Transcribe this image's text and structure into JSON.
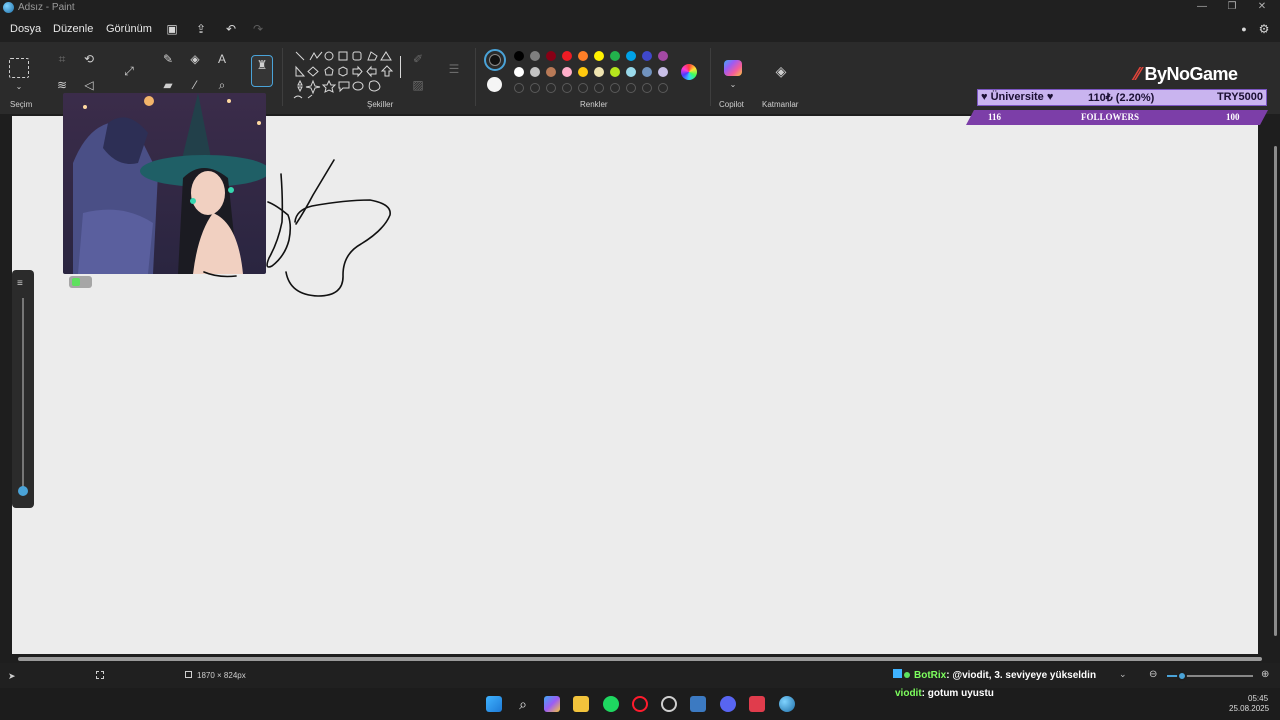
{
  "window": {
    "title": "Adsız - Paint"
  },
  "menu": {
    "file": "Dosya",
    "edit": "Düzenle",
    "view": "Görünüm"
  },
  "ribbon": {
    "selection_label": "Seçim",
    "tools_label_partial": "lar",
    "shapes_label": "Şekiller",
    "colors_label": "Renkler",
    "copilot_label": "Copilot",
    "layers_label": "Katmanlar",
    "palette_row1": [
      "#000000",
      "#7f7f7f",
      "#880015",
      "#ed1c24",
      "#ff7f27",
      "#fff200",
      "#22b14c",
      "#00a2e8",
      "#3f48cc",
      "#a349a4"
    ],
    "palette_row2": [
      "#ffffff",
      "#c3c3c3",
      "#b97a57",
      "#ffaec9",
      "#ffc90e",
      "#efe4b0",
      "#b5e61d",
      "#99d9ea",
      "#7092be",
      "#c8bfe7"
    ],
    "primary_color": "#111111",
    "secondary_color": "#f5f5f5"
  },
  "overlay": {
    "brand": "ByNoGame",
    "ticker_left": "♥ Üniversite ♥",
    "ticker_mid": "110₺ (2.20%)",
    "ticker_right": "TRY5000",
    "followers_left": "116",
    "followers_label": "FOLLOWERS",
    "followers_right": "100"
  },
  "status": {
    "canvas_size": "1870 × 824px"
  },
  "chat": {
    "line1_user": "BotRix",
    "line1_text": ": @viodit, 3. seviyeye yükseldin",
    "line2_user": "viodit",
    "line2_text": ": gotum uyustu"
  },
  "clock": {
    "time": "05:45",
    "date": "25.08.2025"
  }
}
